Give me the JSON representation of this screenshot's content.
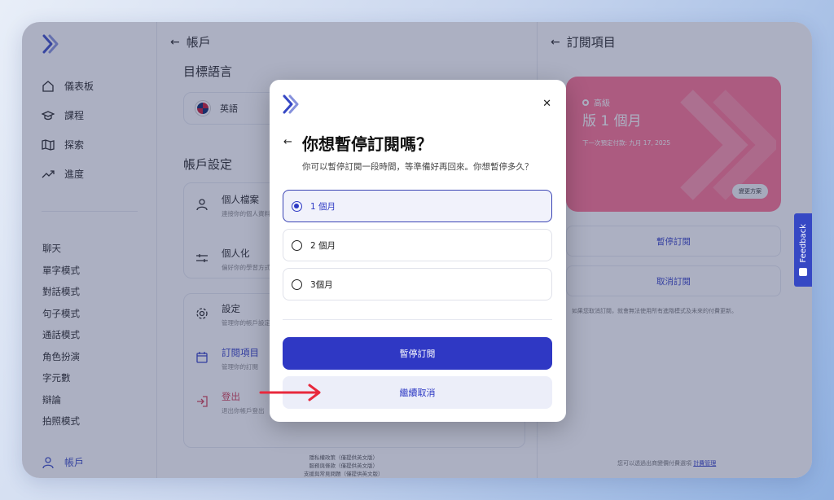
{
  "sidebar": {
    "nav": [
      {
        "label": "儀表板",
        "icon": "home-icon"
      },
      {
        "label": "課程",
        "icon": "graduation-cap-icon"
      },
      {
        "label": "探索",
        "icon": "map-icon"
      },
      {
        "label": "進度",
        "icon": "trend-icon"
      }
    ],
    "tools": [
      "聊天",
      "單字模式",
      "對話模式",
      "句子模式",
      "通話模式",
      "角色扮演",
      "字元數",
      "辯論",
      "拍照模式"
    ],
    "account_label": "帳戶"
  },
  "account": {
    "header": "帳戶",
    "target_language_title": "目標語言",
    "language_value": "英語",
    "settings_title": "帳戶設定",
    "rows": [
      {
        "title": "個人檔案",
        "desc": "連接你的個人資料"
      },
      {
        "title": "個人化",
        "desc": "偏好你的學習方式"
      },
      {
        "title": "設定",
        "desc": "管理你的帳戶設定"
      },
      {
        "title": "訂閱項目",
        "desc": "管理你的訂閱"
      },
      {
        "title": "登出",
        "desc": "退出你帳戶登出"
      }
    ],
    "footnotes": [
      "隱私權政策（僅提供英文版）",
      "服務與條款（僅提供英文版）",
      "支援與常見問題（僅提供英文版）"
    ]
  },
  "subscription": {
    "header": "訂閱項目",
    "plan_tier": "高級",
    "plan_name": "版 1 個月",
    "next_billing": "下一次預定付款: 九月 17, 2025",
    "change_plan": "變更方案",
    "pause_button": "暫停訂閱",
    "cancel_button": "取消訂閱",
    "note": "如果您取消訂閱，就會無法使用所有進階模式及未來的付費更新。",
    "footer_prefix": "您可以透過出商變價付費選項",
    "footer_link": "計費管理"
  },
  "modal": {
    "title": "你想暫停訂閱嗎？",
    "subtitle": "你可以暫停訂閱一段時間，等準備好再回來。你想暫停多久？",
    "options": [
      {
        "label": "1 個月",
        "selected": true
      },
      {
        "label": "2 個月",
        "selected": false
      },
      {
        "label": "3個月",
        "selected": false
      }
    ],
    "primary_button": "暫停訂閱",
    "secondary_button": "繼續取消",
    "close_glyph": "✕",
    "back_glyph": "←"
  },
  "feedback_label": "Feedback",
  "colors": {
    "accent": "#2f38c4",
    "plan_card": "#ff6d8d",
    "danger": "#d23a52",
    "annotation_arrow": "#e8283c"
  }
}
